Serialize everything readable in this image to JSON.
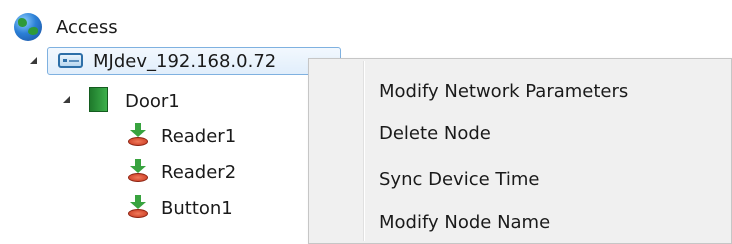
{
  "tree": {
    "root_label": "Access",
    "device_label": "MJdev_192.168.0.72",
    "door_label": "Door1",
    "children": [
      {
        "label": "Reader1",
        "icon": "reader-icon"
      },
      {
        "label": "Reader2",
        "icon": "reader-icon"
      },
      {
        "label": "Button1",
        "icon": "button-icon"
      }
    ]
  },
  "context_menu": {
    "items": [
      {
        "label": "Modify Network Parameters"
      },
      {
        "label": "Delete Node"
      },
      {
        "label": "Sync Device Time"
      },
      {
        "label": "Modify Node Name"
      }
    ]
  },
  "colors": {
    "selection_border": "#7fb1e0",
    "menu_background": "#f0f0f0",
    "door_green": "#2f9a3a"
  }
}
